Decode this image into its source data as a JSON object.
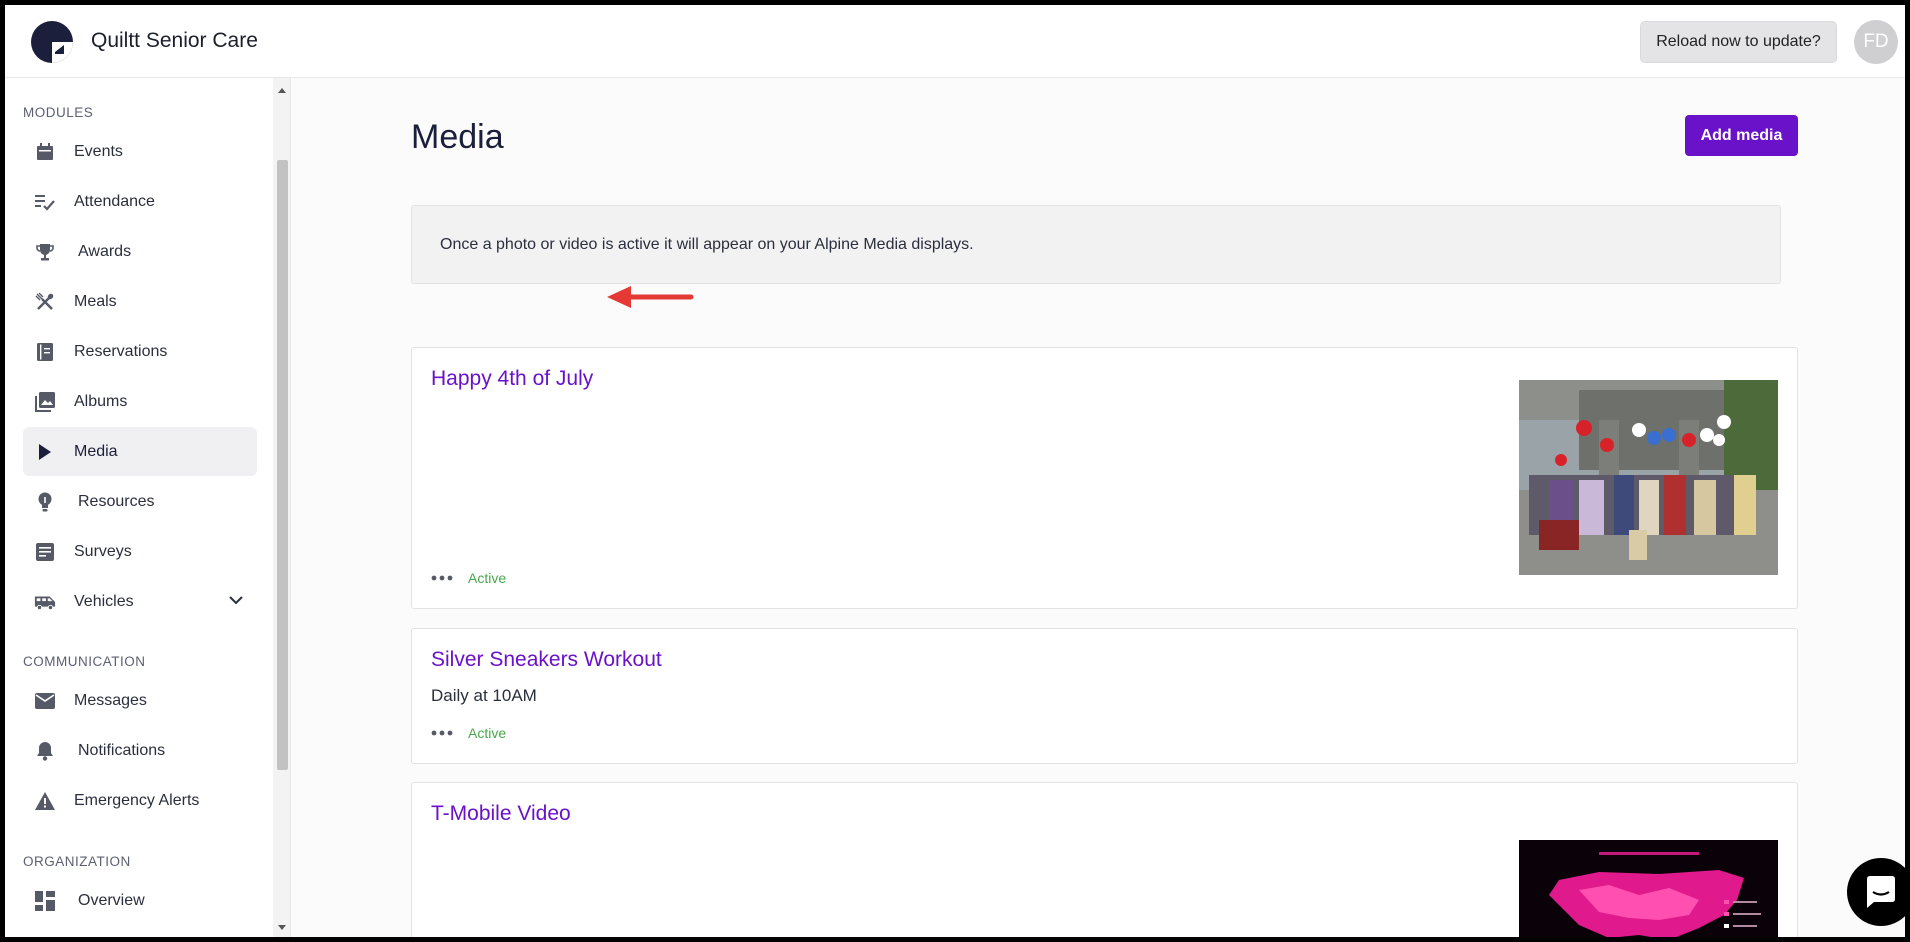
{
  "header": {
    "app_title": "Quiltt Senior Care",
    "reload_label": "Reload now to update?",
    "avatar_initials": "FD"
  },
  "sidebar": {
    "sections": [
      {
        "label": "MODULES",
        "items": [
          {
            "label": "Events",
            "icon": "calendar-icon"
          },
          {
            "label": "Attendance",
            "icon": "checklist-icon"
          },
          {
            "label": "Awards",
            "icon": "trophy-icon"
          },
          {
            "label": "Meals",
            "icon": "utensils-icon"
          },
          {
            "label": "Reservations",
            "icon": "book-icon"
          },
          {
            "label": "Albums",
            "icon": "photos-icon"
          },
          {
            "label": "Media",
            "icon": "play-icon",
            "active": true
          },
          {
            "label": "Resources",
            "icon": "lightbulb-icon"
          },
          {
            "label": "Surveys",
            "icon": "survey-icon"
          },
          {
            "label": "Vehicles",
            "icon": "bus-icon",
            "expandable": true
          }
        ]
      },
      {
        "label": "COMMUNICATION",
        "items": [
          {
            "label": "Messages",
            "icon": "mail-icon"
          },
          {
            "label": "Notifications",
            "icon": "bell-icon"
          },
          {
            "label": "Emergency Alerts",
            "icon": "warning-icon"
          }
        ]
      },
      {
        "label": "ORGANIZATION",
        "items": [
          {
            "label": "Overview",
            "icon": "dashboard-icon"
          }
        ]
      }
    ]
  },
  "main": {
    "title": "Media",
    "add_label": "Add media",
    "info_text": "Once a photo or video is active it will appear on your Alpine Media displays.",
    "cards": [
      {
        "title": "Happy 4th of July",
        "subtitle": "",
        "status": "Active",
        "thumbnail": "balloons-photo"
      },
      {
        "title": "Silver Sneakers Workout",
        "subtitle": "Daily at 10AM",
        "status": "Active",
        "thumbnail": ""
      },
      {
        "title": "T-Mobile Video",
        "subtitle": "",
        "status": "",
        "thumbnail": "coverage-map-video"
      }
    ]
  },
  "colors": {
    "accent": "#6a12c9",
    "active_status": "#49a84c",
    "annotation_arrow": "#e53935"
  }
}
